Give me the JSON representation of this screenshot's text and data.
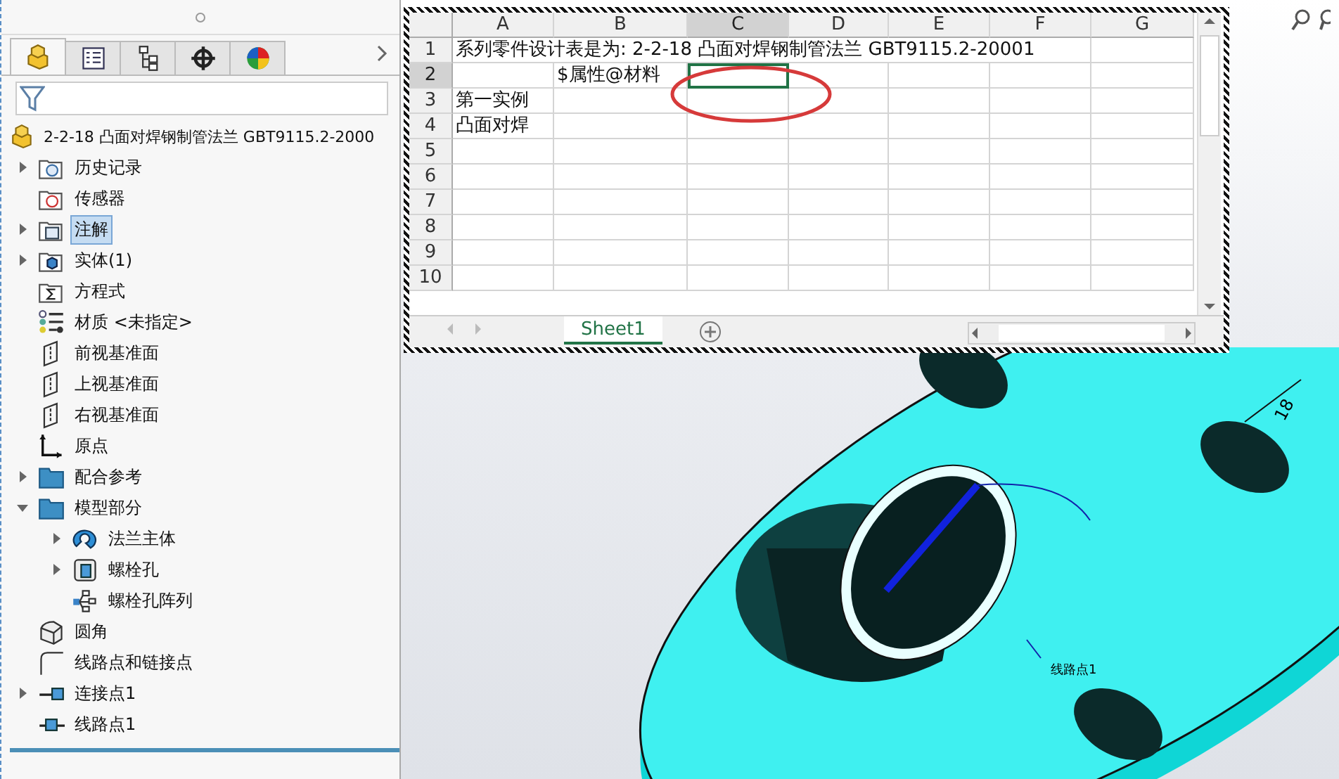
{
  "panel": {
    "tabs": [
      {
        "kind": "part",
        "selected": true
      },
      {
        "kind": "list",
        "selected": false
      },
      {
        "kind": "config",
        "selected": false
      },
      {
        "kind": "target",
        "selected": false
      },
      {
        "kind": "appearance",
        "selected": false
      }
    ],
    "root": {
      "label": "2-2-18 凸面对焊钢制管法兰 GBT9115.2-2000",
      "kind": "part"
    },
    "tree": [
      {
        "label": "历史记录",
        "kind": "folder-history",
        "expanded": false,
        "selected": false
      },
      {
        "label": "传感器",
        "kind": "folder-sensor",
        "selected": false
      },
      {
        "label": "注解",
        "kind": "folder-annotation",
        "expanded": false,
        "selected": true
      },
      {
        "label": "实体(1)",
        "kind": "folder-body",
        "expanded": false,
        "selected": false
      },
      {
        "label": "方程式",
        "kind": "folder-equation",
        "selected": false
      },
      {
        "label": "材质 <未指定>",
        "kind": "material",
        "selected": false
      },
      {
        "label": "前视基准面",
        "kind": "plane",
        "selected": false
      },
      {
        "label": "上视基准面",
        "kind": "plane",
        "selected": false
      },
      {
        "label": "右视基准面",
        "kind": "plane",
        "selected": false
      },
      {
        "label": "原点",
        "kind": "origin",
        "selected": false
      },
      {
        "label": "配合参考",
        "kind": "folder",
        "expanded": false,
        "selected": false
      },
      {
        "label": "模型部分",
        "kind": "folder",
        "expanded": true,
        "selected": false,
        "children": [
          {
            "label": "法兰主体",
            "kind": "revolve",
            "expanded": false,
            "selected": false
          },
          {
            "label": "螺栓孔",
            "kind": "hole",
            "expanded": false,
            "selected": false
          },
          {
            "label": "螺栓孔阵列",
            "kind": "pattern",
            "selected": false
          }
        ]
      },
      {
        "label": "圆角",
        "kind": "fillet",
        "selected": false
      },
      {
        "label": "线路点和链接点",
        "kind": "sketch",
        "selected": false
      },
      {
        "label": "连接点1",
        "kind": "connection",
        "expanded": false,
        "selected": false
      },
      {
        "label": "线路点1",
        "kind": "route-point",
        "selected": false
      }
    ]
  },
  "spreadsheet": {
    "columns": [
      {
        "label": "A",
        "selected": false
      },
      {
        "label": "B",
        "selected": false
      },
      {
        "label": "C",
        "selected": true
      },
      {
        "label": "D",
        "selected": false
      },
      {
        "label": "E",
        "selected": false
      },
      {
        "label": "F",
        "selected": false
      },
      {
        "label": "G",
        "selected": false
      }
    ],
    "rows": [
      {
        "label": "1",
        "selected": false,
        "cells": [
          "系列零件设计表是为:   2-2-18 凸面对焊钢制管法兰 GBT9115.2-20001"
        ]
      },
      {
        "label": "2",
        "selected": true,
        "cells": [
          null,
          "$属性@材料"
        ]
      },
      {
        "label": "3",
        "selected": false,
        "cells": [
          "第一实例"
        ]
      },
      {
        "label": "4",
        "selected": false,
        "cells": [
          "凸面对焊"
        ]
      },
      {
        "label": "5",
        "selected": false
      },
      {
        "label": "6",
        "selected": false
      },
      {
        "label": "7",
        "selected": false
      },
      {
        "label": "8",
        "selected": false
      },
      {
        "label": "9",
        "selected": false
      },
      {
        "label": "10",
        "selected": false
      }
    ],
    "sheet_tabs": [
      {
        "label": "Sheet1",
        "selected": true
      }
    ]
  },
  "model": {
    "labels": [
      {
        "kind": "dimension",
        "text": "18"
      },
      {
        "kind": "point",
        "text": "线路点1"
      }
    ]
  }
}
